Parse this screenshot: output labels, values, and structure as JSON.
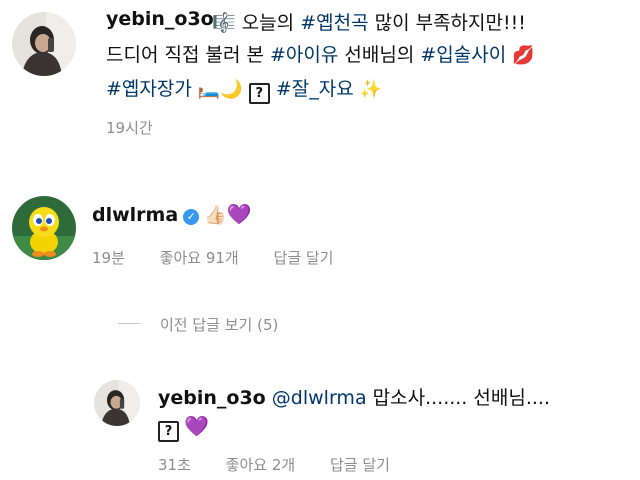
{
  "post": {
    "username": "yebin_o3o",
    "line1_a": "🎼 오늘의 ",
    "tag1": "#옙천곡",
    "line1_b": " 많이 부족하지만!!!",
    "line2_a": "드디어 직접 불러 본 ",
    "tag2": "#아이유",
    "line2_b": " 선배님의 ",
    "tag3": "#입술사이",
    "lips_emoji": "💋",
    "tag4": "#옙자장가",
    "line3_emojis": "🛏️🌙",
    "question_box": "?",
    "tag5": "#잘_자요",
    "sparkle_emoji": "✨",
    "time": "19시간"
  },
  "comment": {
    "username": "dlwlrma",
    "verified_mark": "✓",
    "thumbs_emoji": "👍🏻",
    "heart_emoji": "💜",
    "time": "19분",
    "likes": "좋아요 91개",
    "reply": "답글 달기"
  },
  "view_replies": "이전 답글 보기 (5)",
  "reply": {
    "username": "yebin_o3o",
    "mention": "@dlwlrma",
    "text": " 맙소사....... 선배님....",
    "question_box": "?",
    "heart_emoji": "💜",
    "time": "31초",
    "likes": "좋아요 2개",
    "reply": "답글 달기"
  },
  "colors": {
    "hashtag": "#00376b",
    "meta": "#8e8e8e",
    "verified": "#3897f0",
    "heart": "#8a2be2"
  },
  "icons": [
    "profile-avatar-photo",
    "tweety-avatar",
    "verified-badge"
  ]
}
